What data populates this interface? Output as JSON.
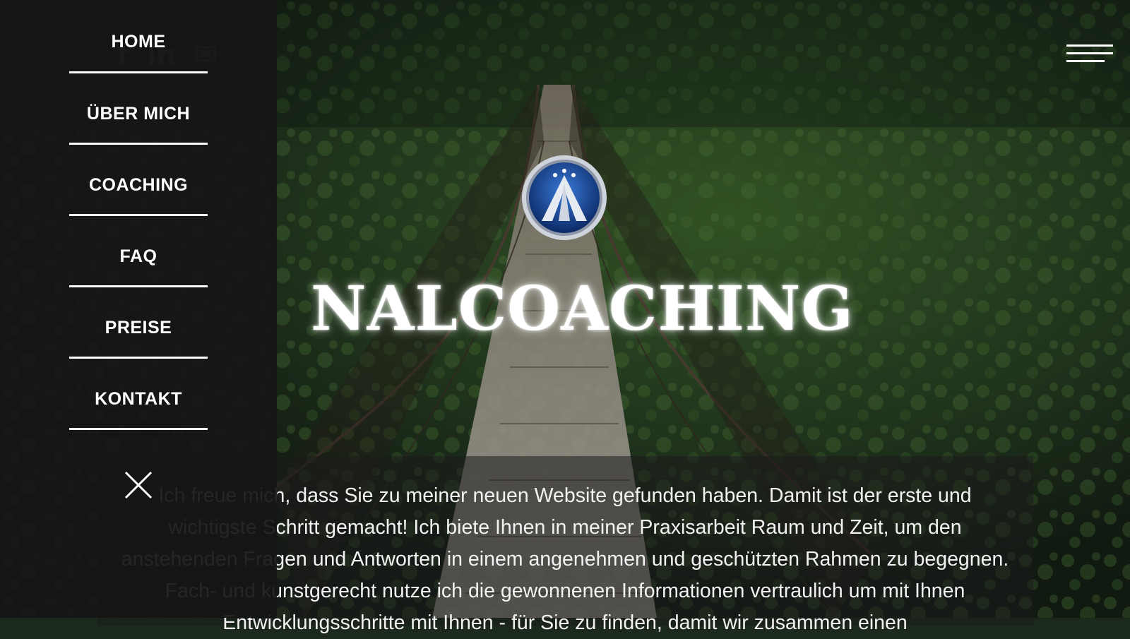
{
  "nav": {
    "items": [
      {
        "label": "HOME"
      },
      {
        "label": "ÜBER MICH"
      },
      {
        "label": "COACHING"
      },
      {
        "label": "FAQ"
      },
      {
        "label": "PREISE"
      },
      {
        "label": "KONTAKT"
      }
    ],
    "close_icon": "close-icon"
  },
  "header": {
    "menu_icon": "hamburger-menu-icon",
    "social": [
      {
        "icon": "facebook-icon",
        "glyph": "f"
      },
      {
        "icon": "linkedin-icon",
        "glyph": "in"
      },
      {
        "icon": "mail-icon",
        "glyph": "✉"
      }
    ]
  },
  "hero": {
    "logo_icon": "logo-emblem",
    "title": "NALCOACHING",
    "intro": "Ich freue mich, dass Sie zu meiner neuen Website gefunden haben. Damit ist der erste und wichtigste Schritt gemacht! Ich biete Ihnen in meiner Praxisarbeit Raum und Zeit, um den anstehenden Fragen und Antworten in einem angenehmen und geschützten Rahmen zu begegnen. Fach- und kunstgerecht nutze ich die gewonnenen Informationen vertraulich um mit Ihnen Entwicklungsschritte mit Ihnen - für Sie zu finden, damit wir zusammen einen"
  },
  "colors": {
    "menu_bg": "#161616",
    "text": "#ffffff",
    "forest_dark": "#1b2a1c",
    "forest_green": "#3f6a2e"
  }
}
